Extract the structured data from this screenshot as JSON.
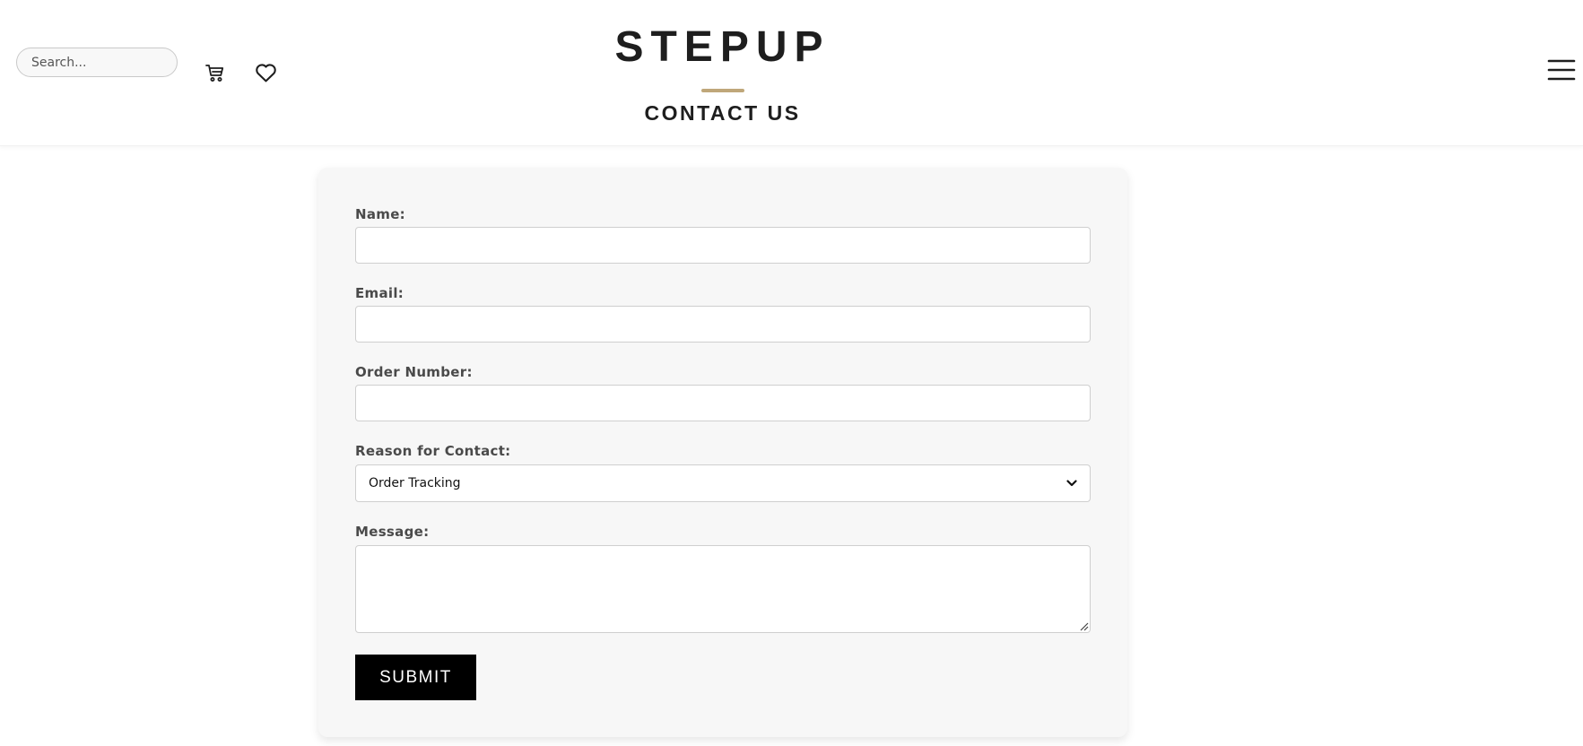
{
  "header": {
    "search": {
      "placeholder": "Search...",
      "value": ""
    },
    "brand": "STEPUP",
    "page_title": "CONTACT US",
    "accent_color": "#bfa77a",
    "icons": {
      "cart": "cart-icon",
      "wishlist": "heart-icon",
      "menu": "hamburger-menu-icon"
    }
  },
  "form": {
    "name": {
      "label": "Name:",
      "value": ""
    },
    "email": {
      "label": "Email:",
      "value": ""
    },
    "order_number": {
      "label": "Order Number:",
      "value": ""
    },
    "reason": {
      "label": "Reason for Contact:",
      "selected": "Order Tracking"
    },
    "message": {
      "label": "Message:",
      "value": ""
    },
    "submit_label": "SUBMIT"
  }
}
